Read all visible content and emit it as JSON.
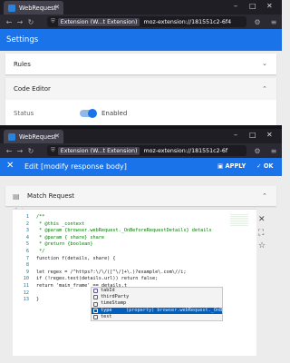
{
  "window1": {
    "tab_title": "WebRequest",
    "url_chip": "Extension (W...t Extension)",
    "url_text": "moz-extension://181551c2-6f4"
  },
  "settings": {
    "header": "Settings",
    "rules_label": "Rules",
    "code_editor_label": "Code Editor",
    "status_label": "Status",
    "status_value": "Enabled"
  },
  "window2": {
    "tab_title": "WebRequest",
    "url_chip": "Extension (W...t Extension)",
    "url_text": "moz-extension://181551c2-6f"
  },
  "editor": {
    "title": "Edit [modify response body]",
    "apply_label": "APPLY",
    "ok_label": "OK",
    "section_label": "Match Request",
    "code_label": "Code"
  },
  "code": {
    "lines": [
      {
        "n": "1",
        "t": "/**"
      },
      {
        "n": "2",
        "t": " * @this _context"
      },
      {
        "n": "3",
        "t": " * @param {browser.webRequest._OnBeforeRequestDetails} details"
      },
      {
        "n": "4",
        "t": " * @param { share} share"
      },
      {
        "n": "5",
        "t": " * @return {boolean}"
      },
      {
        "n": "6",
        "t": " */"
      },
      {
        "n": "7",
        "t": "function f(details, share) {"
      },
      {
        "n": "8",
        "t": ""
      },
      {
        "n": "9",
        "t": "let regex = /^https?:\\/\\/([^\\/]+\\.)?example\\.com\\//i;"
      },
      {
        "n": "10",
        "t": "if (!regex.test(details.url)) return false;"
      },
      {
        "n": "11",
        "t": "return 'main_frame' == details.t"
      },
      {
        "n": "12",
        "t": ""
      },
      {
        "n": "13",
        "t": "}"
      }
    ]
  },
  "suggestions": {
    "items": [
      "tabId",
      "thirdParty",
      "timeStamp",
      "type",
      "test"
    ],
    "selected_detail": "(property) browser.webRequest._OnBefore..."
  }
}
